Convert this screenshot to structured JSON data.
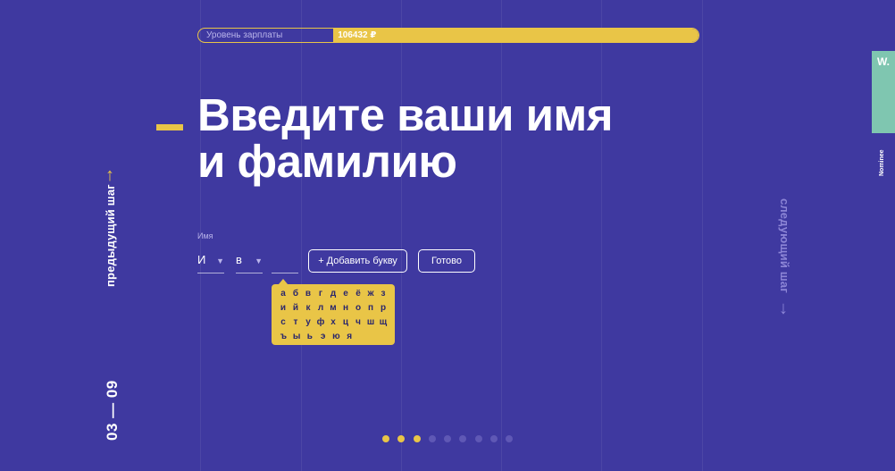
{
  "salary": {
    "label": "Уровень зарплаты",
    "value": "106432 ₽",
    "fill_fraction": 0.73
  },
  "title": {
    "line1": "Введите ваши имя",
    "line2": "и фамилию"
  },
  "nav": {
    "prev_label": "предыдущий шаг",
    "prev_arrow": "↑",
    "next_label": "следующий шаг",
    "next_arrow": "↓"
  },
  "step": {
    "current": "03",
    "total": "09",
    "display": "03 — 09"
  },
  "badge": {
    "mark": "W.",
    "label": "Nominee"
  },
  "name_field": {
    "label": "Имя",
    "letters": [
      "И",
      "в"
    ],
    "caret": "▼"
  },
  "buttons": {
    "add_letter": "+ Добавить букву",
    "done": "Готово"
  },
  "alphabet": [
    [
      "а",
      "б",
      "в",
      "г",
      "д",
      "е",
      "ё",
      "ж",
      "з"
    ],
    [
      "и",
      "й",
      "к",
      "л",
      "м",
      "н",
      "о",
      "п",
      "р"
    ],
    [
      "с",
      "т",
      "у",
      "ф",
      "х",
      "ц",
      "ч",
      "ш",
      "щ"
    ],
    [
      "ъ",
      "ы",
      "ь",
      "э",
      "ю",
      "я"
    ]
  ],
  "progress": {
    "total_steps": 9,
    "completed": 3
  },
  "colors": {
    "background": "#3f39a0",
    "accent": "#e9c547",
    "badge": "#7fc6b0",
    "muted": "#8c85d6"
  }
}
